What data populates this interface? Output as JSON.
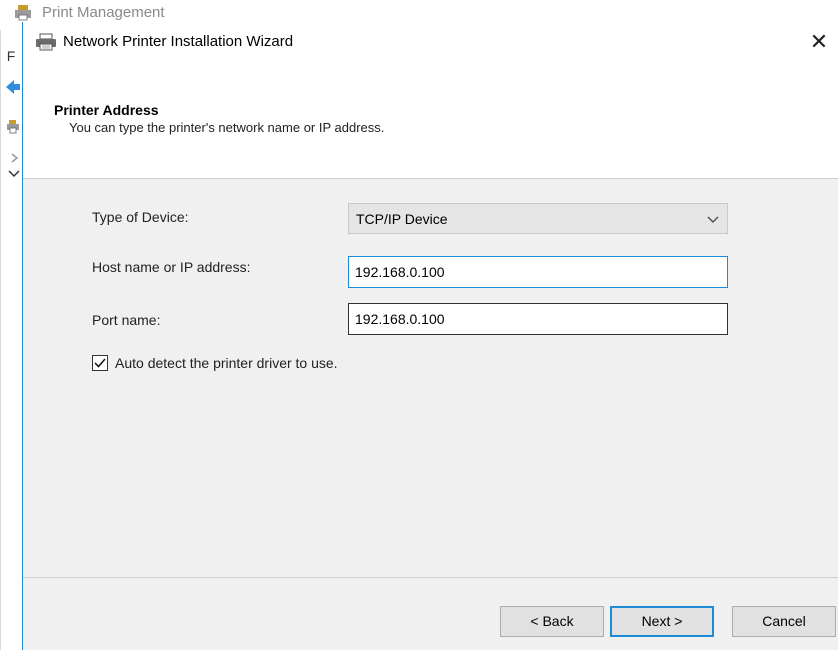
{
  "background_window": {
    "title": "Print Management",
    "menu_letter": "F"
  },
  "dialog": {
    "title": "Network Printer Installation Wizard",
    "close_glyph": "✕",
    "header": {
      "title": "Printer Address",
      "subtitle": "You can type the printer's network name or IP address."
    },
    "form": {
      "type_label": "Type of Device:",
      "type_value": "TCP/IP Device",
      "host_label": "Host name or IP address:",
      "host_value": "192.168.0.100",
      "port_label": "Port name:",
      "port_value": "192.168.0.100",
      "auto_detect_label": "Auto detect the printer driver to use.",
      "auto_detect_checked": true
    },
    "buttons": {
      "back": "< Back",
      "next": "Next >",
      "cancel": "Cancel"
    }
  },
  "colors": {
    "accent": "#1e8bd6",
    "dialog_bg": "#f0f0f0",
    "header_bg": "#ffffff"
  }
}
